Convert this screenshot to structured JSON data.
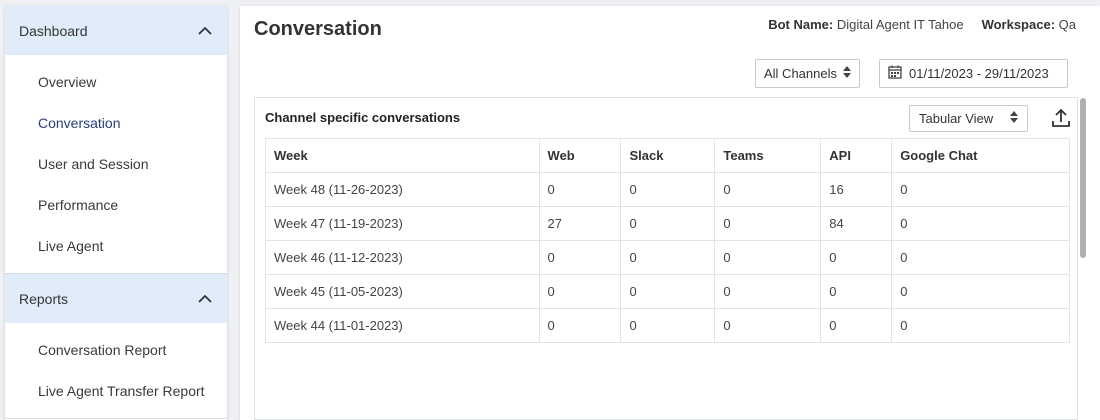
{
  "sidebar": {
    "sections": [
      {
        "title": "Dashboard",
        "items": [
          {
            "label": "Overview"
          },
          {
            "label": "Conversation"
          },
          {
            "label": "User and Session"
          },
          {
            "label": "Performance"
          },
          {
            "label": "Live Agent"
          }
        ]
      },
      {
        "title": "Reports",
        "items": [
          {
            "label": "Conversation Report"
          },
          {
            "label": "Live Agent Transfer Report"
          }
        ]
      }
    ],
    "active_item": "Conversation"
  },
  "header": {
    "title": "Conversation",
    "bot_name_label": "Bot Name:",
    "bot_name_value": "Digital Agent IT Tahoe",
    "workspace_label": "Workspace:",
    "workspace_value": "Qa"
  },
  "filters": {
    "channel_selected": "All Channels",
    "date_range": "01/11/2023 - 29/11/2023"
  },
  "card": {
    "title": "Channel specific conversations",
    "view_selected": "Tabular View",
    "columns": [
      "Week",
      "Web",
      "Slack",
      "Teams",
      "API",
      "Google Chat"
    ],
    "rows": [
      [
        "Week 48 (11-26-2023)",
        "0",
        "0",
        "0",
        "16",
        "0"
      ],
      [
        "Week 47 (11-19-2023)",
        "27",
        "0",
        "0",
        "84",
        "0"
      ],
      [
        "Week 46 (11-12-2023)",
        "0",
        "0",
        "0",
        "0",
        "0"
      ],
      [
        "Week 45 (11-05-2023)",
        "0",
        "0",
        "0",
        "0",
        "0"
      ],
      [
        "Week 44 (11-01-2023)",
        "0",
        "0",
        "0",
        "0",
        "0"
      ]
    ]
  },
  "colors": {
    "section_header_bg": "#e0ecfa",
    "active_item": "#2a3f7a"
  }
}
